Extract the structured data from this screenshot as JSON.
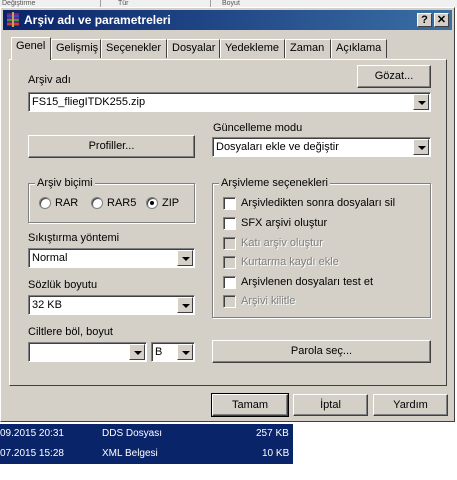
{
  "background": {
    "header_cols": [
      "Değiştirme tarihi",
      "Tür",
      "Boyut"
    ],
    "rows": [
      {
        "date": "09.2015 20:31",
        "type": "DDS Dosyası",
        "size": "257 KB"
      },
      {
        "date": "07.2015 15:28",
        "type": "XML Belgesi",
        "size": "10 KB"
      }
    ]
  },
  "dialog": {
    "title": "Arşiv adı ve parametreleri",
    "help_button": "?",
    "close_button": "✕",
    "tabs": [
      "Genel",
      "Gelişmiş",
      "Seçenekler",
      "Dosyalar",
      "Yedekleme",
      "Zaman",
      "Açıklama"
    ],
    "archive_name_label": "Arşiv adı",
    "browse_button": "Gözat...",
    "archive_name_value": "FS15_fliegITDK255.zip",
    "profiles_button": "Profiller...",
    "update_mode_label": "Güncelleme modu",
    "update_mode_value": "Dosyaları ekle ve değiştir",
    "archive_format": {
      "legend": "Arşiv biçimi",
      "options": [
        "RAR",
        "RAR5",
        "ZIP"
      ],
      "selected": "ZIP"
    },
    "compression_label": "Sıkıştırma yöntemi",
    "compression_value": "Normal",
    "dictionary_label": "Sözlük boyutu",
    "dictionary_value": "32 KB",
    "split_label": "Ciltlere böl, boyut",
    "split_value": "",
    "split_unit": "B",
    "archiving_options": {
      "legend": "Arşivleme seçenekleri",
      "items": [
        {
          "label": "Arşivledikten sonra dosyaları sil",
          "enabled": true,
          "checked": false
        },
        {
          "label": "SFX arşivi oluştur",
          "enabled": true,
          "checked": false
        },
        {
          "label": "Katı arşiv oluştur",
          "enabled": false,
          "checked": false
        },
        {
          "label": "Kurtarma kaydı ekle",
          "enabled": false,
          "checked": false
        },
        {
          "label": "Arşivlenen dosyaları test et",
          "enabled": true,
          "checked": false
        },
        {
          "label": "Arşivi kilitle",
          "enabled": false,
          "checked": false
        }
      ]
    },
    "password_button": "Parola seç...",
    "ok_button": "Tamam",
    "cancel_button": "İptal",
    "help_bottom_button": "Yardım"
  }
}
